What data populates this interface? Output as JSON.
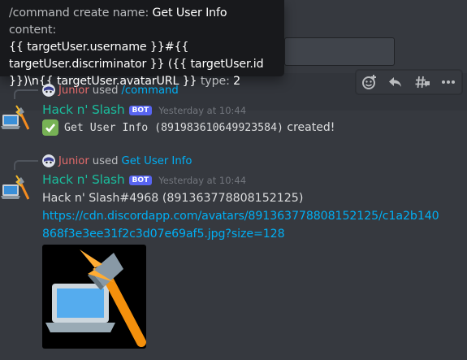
{
  "tooltip": {
    "line1_a": "/command create name: ",
    "line1_b": "Get User Info",
    "line1_c": " content:",
    "line2": "{{ targetUser.username }}#{{",
    "line3": "targetUser.discriminator }} ({{ targetUser.id",
    "line4_a": "}})\\n{{ targetUser.avatarURL }}",
    "line4_b": " type: ",
    "line4_c": "2"
  },
  "toolbar": {
    "icons": [
      "add-reaction-icon",
      "reply-icon",
      "create-thread-icon",
      "more-icon"
    ]
  },
  "messages": [
    {
      "reply": {
        "user": "Junior",
        "used": "used",
        "command": "/command"
      },
      "author": "Hack n' Slash",
      "tag": "BOT",
      "timestamp": "Yesterday at 10:44",
      "content": "Get User Info (891983610649923584)",
      "content_suffix": " created!"
    },
    {
      "reply": {
        "user": "Junior",
        "used": "used",
        "command": "Get User Info"
      },
      "author": "Hack n' Slash",
      "tag": "BOT",
      "timestamp": "Yesterday at 10:44",
      "line1": "Hack n' Slash#4968 (891363778808152125)",
      "link_line1": "https://cdn.discordapp.com/avatars/891363778808152125/c1a2b140",
      "link_line2": "868f3e3ee31f2c3d07e69af5.jpg?size=128"
    }
  ],
  "colors": {
    "background": "#36393f",
    "bot_name": "#1abc9c",
    "bot_tag": "#5865f2",
    "link": "#00aff4",
    "reply_user": "#e46b6b"
  }
}
